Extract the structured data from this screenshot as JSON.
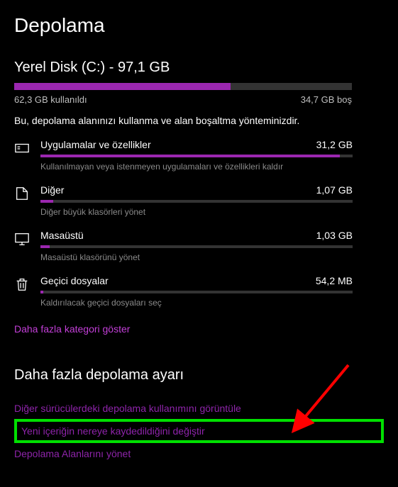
{
  "page_title": "Depolama",
  "disk": {
    "title": "Yerel Disk (C:) - 97,1 GB",
    "used_label": "62,3 GB kullanıldı",
    "free_label": "34,7 GB boş",
    "used_percent": 64
  },
  "description": "Bu, depolama alanınızı kullanma ve alan boşaltma yönteminizdir.",
  "categories": [
    {
      "icon": "apps-icon",
      "name": "Uygulamalar ve özellikler",
      "size": "31,2 GB",
      "sub": "Kullanılmayan veya istenmeyen uygulamaları ve özellikleri kaldır",
      "fill_percent": 96
    },
    {
      "icon": "other-icon",
      "name": "Diğer",
      "size": "1,07 GB",
      "sub": "Diğer büyük klasörleri yönet",
      "fill_percent": 4
    },
    {
      "icon": "desktop-icon",
      "name": "Masaüstü",
      "size": "1,03 GB",
      "sub": "Masaüstü klasörünü yönet",
      "fill_percent": 3
    },
    {
      "icon": "temp-icon",
      "name": "Geçici dosyalar",
      "size": "54,2 MB",
      "sub": "Kaldırılacak geçici dosyaları seç",
      "fill_percent": 1
    }
  ],
  "more_categories_label": "Daha fazla kategori göster",
  "more_settings_title": "Daha fazla depolama ayarı",
  "links": {
    "other_drives": "Diğer sürücülerdeki depolama kullanımını görüntüle",
    "change_save": "Yeni içeriğin nereye kaydedildiğini değiştir",
    "storage_spaces": "Depolama Alanlarını yönet"
  }
}
